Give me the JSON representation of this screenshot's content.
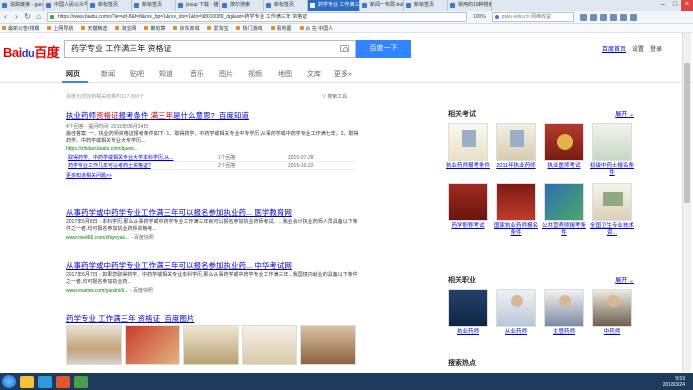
{
  "browser": {
    "tabs": [
      {
        "label": "追踪链接 - gaojianqiu",
        "active": false
      },
      {
        "label": "中国人民公众号",
        "active": false
      },
      {
        "label": "新标签页",
        "active": false
      },
      {
        "label": "新标签页",
        "active": false
      },
      {
        "label": "jsxup 下载 - 播放搜索",
        "active": false
      },
      {
        "label": "搜尔搜索",
        "active": false
      },
      {
        "label": "新标签页",
        "active": false
      },
      {
        "label": "药学专业 工作满三年 资格",
        "active": true
      },
      {
        "label": "新闻一布局-bubuka",
        "active": false
      },
      {
        "label": "新标签页",
        "active": false
      },
      {
        "label": "常用的10种搜索引擎",
        "active": false
      }
    ],
    "url": "https://www.baidu.com/s?ie=utf-8&f=8&rsv_bp=1&rsv_idx=1&tn=98010089_dg&wd=药学专业 工作满三年 资格证",
    "zoom": "100%",
    "side_search_placeholder": "qiwu.eelu.cn 网维收益",
    "bookmarks": [
      "最新公告/排期",
      "上网导航",
      "天猫精选",
      "淘宝网",
      "聚划算",
      "京东商城",
      "爱淘宝",
      "热门游戏",
      "看地图",
      "从 在 中国人"
    ]
  },
  "baidu": {
    "logo_part1": "Bai",
    "logo_paw": "du",
    "logo_part2": "百度",
    "query": "药学专业 工作满三年 资格证",
    "search_button": "百度一下",
    "header_links": {
      "home": "百度首页",
      "settings": "设置",
      "login": "登录"
    }
  },
  "nav": {
    "items": [
      "网页",
      "新闻",
      "贴吧",
      "知道",
      "音乐",
      "图片",
      "视频",
      "地图",
      "文库",
      "更多»"
    ],
    "active_index": 0
  },
  "results": {
    "count_text": "百度为您找到相关结果约127,000个",
    "search_tools": "搜索工具",
    "items": [
      {
        "title_pre": "执业药师",
        "title_em": "资格证",
        "title_mid": "报考条件 ",
        "title_em2": "满三年",
        "title_post": "是什么意思?_百度知道",
        "meta": "4个回答 - 提问时间: 2015年08月24日",
        "abstract": "最佳答案: 一、执业药师资格证报考条件如下: 1、取得药学、中药学或相关专业中专学历,从事药学或中药学专业工作满七年。2、取得药学、中药学或相关专业大专学历...",
        "url": "https://zhidao.baidu.com/quest...",
        "sub": [
          {
            "q": "取得药学、中药学或相关专业大学本科学历,从...",
            "n": "1个回答",
            "d": "2015-07-28"
          },
          {
            "q": "药学专业工作几年可以考药士资格证?",
            "n": "2个回答",
            "d": "2015-10-22"
          }
        ],
        "more": "更多知道相关问题>>"
      },
      {
        "title": "从事药学或中药学专业工作满三年可以报名参加执业药... 医学教育网",
        "abstract": "2017年6月8日 - 本科学历,那么从事药学或中药学专业工作满三年就可以报名参加执业药师考试。...我业会计执业药师人员具备以下条件之一者,均可报名参加执业药师资格考...",
        "url": "www.med66.com/zhiyeyao...",
        "snap": "百度快照"
      },
      {
        "title": "从事药学或中药学专业工作满三年可以报名参加执业药... 中华考试网",
        "abstract": "2017年6月7日 - 如果您取得药学、中药学或相关专业本科学历,那么从事药学或中药学专业工作满三年...我国境内就业的具备以下条件之一者,均可报名参加执业药...",
        "url": "www.examw.com/yaoshi/b...",
        "snap": "百度快照"
      },
      {
        "title": "药学专业 工作满三年 资格证_百度图片"
      }
    ]
  },
  "right": {
    "related_exams_title": "相关考试",
    "expand": "展开",
    "exams": [
      "执业药师报考条件",
      "2011年执业药师",
      "执业医师考试",
      "初级中药士报名条件",
      "药学职称考试",
      "国家执业药师报名条件",
      "公共营养师报考条件",
      "全国卫生专业技术资..."
    ],
    "related_jobs_title": "相关职业",
    "jobs": [
      "执业药师",
      "从业药师",
      "主管药师",
      "中药师"
    ],
    "hot_title": "搜索热点"
  },
  "taskbar": {
    "time": "9:53",
    "date": "2018/3/24"
  }
}
